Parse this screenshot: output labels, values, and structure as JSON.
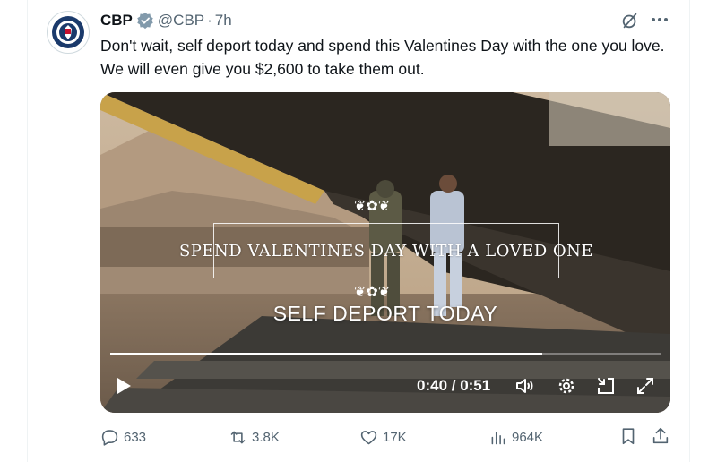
{
  "tweet": {
    "author_name": "CBP",
    "handle": "@CBP",
    "separator": "·",
    "time": "7h",
    "text": "Don't wait, self deport today and spend this Valentines Day with the one you love. We will even give you $2,600 to take them out."
  },
  "video": {
    "overlay_title": "SPEND VALENTINES DAY WITH A LOVED ONE",
    "overlay_subtitle": "SELF DEPORT TODAY",
    "timecode": "0:40 / 0:51",
    "progress": 0.7843
  },
  "actions": {
    "replies": "633",
    "reposts": "3.8K",
    "likes": "17K",
    "views": "964K"
  },
  "colors": {
    "accent": "#1d9bf0",
    "muted_text": "#536471",
    "verified_gray": "#829aab"
  },
  "icons": [
    "verified-badge-icon",
    "grok-icon",
    "more-icon",
    "play-icon",
    "volume-icon",
    "settings-icon",
    "minimize-icon",
    "fullscreen-icon",
    "reply-icon",
    "repost-icon",
    "like-icon",
    "views-icon",
    "bookmark-icon",
    "share-icon"
  ]
}
